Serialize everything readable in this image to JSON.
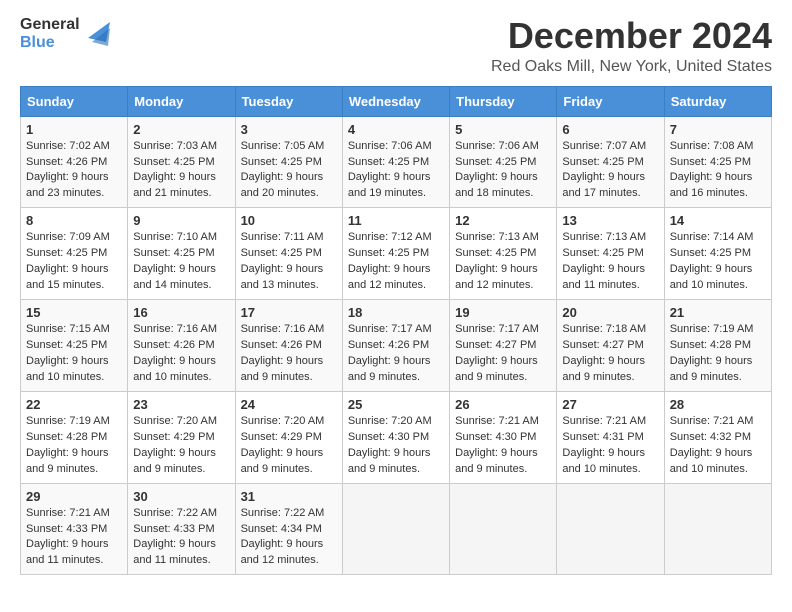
{
  "logo": {
    "text_general": "General",
    "text_blue": "Blue"
  },
  "header": {
    "title": "December 2024",
    "subtitle": "Red Oaks Mill, New York, United States"
  },
  "weekdays": [
    "Sunday",
    "Monday",
    "Tuesday",
    "Wednesday",
    "Thursday",
    "Friday",
    "Saturday"
  ],
  "weeks": [
    [
      {
        "day": "1",
        "sunrise": "7:02 AM",
        "sunset": "4:26 PM",
        "daylight": "9 hours and 23 minutes."
      },
      {
        "day": "2",
        "sunrise": "7:03 AM",
        "sunset": "4:25 PM",
        "daylight": "9 hours and 21 minutes."
      },
      {
        "day": "3",
        "sunrise": "7:05 AM",
        "sunset": "4:25 PM",
        "daylight": "9 hours and 20 minutes."
      },
      {
        "day": "4",
        "sunrise": "7:06 AM",
        "sunset": "4:25 PM",
        "daylight": "9 hours and 19 minutes."
      },
      {
        "day": "5",
        "sunrise": "7:06 AM",
        "sunset": "4:25 PM",
        "daylight": "9 hours and 18 minutes."
      },
      {
        "day": "6",
        "sunrise": "7:07 AM",
        "sunset": "4:25 PM",
        "daylight": "9 hours and 17 minutes."
      },
      {
        "day": "7",
        "sunrise": "7:08 AM",
        "sunset": "4:25 PM",
        "daylight": "9 hours and 16 minutes."
      }
    ],
    [
      {
        "day": "8",
        "sunrise": "7:09 AM",
        "sunset": "4:25 PM",
        "daylight": "9 hours and 15 minutes."
      },
      {
        "day": "9",
        "sunrise": "7:10 AM",
        "sunset": "4:25 PM",
        "daylight": "9 hours and 14 minutes."
      },
      {
        "day": "10",
        "sunrise": "7:11 AM",
        "sunset": "4:25 PM",
        "daylight": "9 hours and 13 minutes."
      },
      {
        "day": "11",
        "sunrise": "7:12 AM",
        "sunset": "4:25 PM",
        "daylight": "9 hours and 12 minutes."
      },
      {
        "day": "12",
        "sunrise": "7:13 AM",
        "sunset": "4:25 PM",
        "daylight": "9 hours and 12 minutes."
      },
      {
        "day": "13",
        "sunrise": "7:13 AM",
        "sunset": "4:25 PM",
        "daylight": "9 hours and 11 minutes."
      },
      {
        "day": "14",
        "sunrise": "7:14 AM",
        "sunset": "4:25 PM",
        "daylight": "9 hours and 10 minutes."
      }
    ],
    [
      {
        "day": "15",
        "sunrise": "7:15 AM",
        "sunset": "4:25 PM",
        "daylight": "9 hours and 10 minutes."
      },
      {
        "day": "16",
        "sunrise": "7:16 AM",
        "sunset": "4:26 PM",
        "daylight": "9 hours and 10 minutes."
      },
      {
        "day": "17",
        "sunrise": "7:16 AM",
        "sunset": "4:26 PM",
        "daylight": "9 hours and 9 minutes."
      },
      {
        "day": "18",
        "sunrise": "7:17 AM",
        "sunset": "4:26 PM",
        "daylight": "9 hours and 9 minutes."
      },
      {
        "day": "19",
        "sunrise": "7:17 AM",
        "sunset": "4:27 PM",
        "daylight": "9 hours and 9 minutes."
      },
      {
        "day": "20",
        "sunrise": "7:18 AM",
        "sunset": "4:27 PM",
        "daylight": "9 hours and 9 minutes."
      },
      {
        "day": "21",
        "sunrise": "7:19 AM",
        "sunset": "4:28 PM",
        "daylight": "9 hours and 9 minutes."
      }
    ],
    [
      {
        "day": "22",
        "sunrise": "7:19 AM",
        "sunset": "4:28 PM",
        "daylight": "9 hours and 9 minutes."
      },
      {
        "day": "23",
        "sunrise": "7:20 AM",
        "sunset": "4:29 PM",
        "daylight": "9 hours and 9 minutes."
      },
      {
        "day": "24",
        "sunrise": "7:20 AM",
        "sunset": "4:29 PM",
        "daylight": "9 hours and 9 minutes."
      },
      {
        "day": "25",
        "sunrise": "7:20 AM",
        "sunset": "4:30 PM",
        "daylight": "9 hours and 9 minutes."
      },
      {
        "day": "26",
        "sunrise": "7:21 AM",
        "sunset": "4:30 PM",
        "daylight": "9 hours and 9 minutes."
      },
      {
        "day": "27",
        "sunrise": "7:21 AM",
        "sunset": "4:31 PM",
        "daylight": "9 hours and 10 minutes."
      },
      {
        "day": "28",
        "sunrise": "7:21 AM",
        "sunset": "4:32 PM",
        "daylight": "9 hours and 10 minutes."
      }
    ],
    [
      {
        "day": "29",
        "sunrise": "7:21 AM",
        "sunset": "4:33 PM",
        "daylight": "9 hours and 11 minutes."
      },
      {
        "day": "30",
        "sunrise": "7:22 AM",
        "sunset": "4:33 PM",
        "daylight": "9 hours and 11 minutes."
      },
      {
        "day": "31",
        "sunrise": "7:22 AM",
        "sunset": "4:34 PM",
        "daylight": "9 hours and 12 minutes."
      },
      null,
      null,
      null,
      null
    ]
  ],
  "labels": {
    "sunrise": "Sunrise:",
    "sunset": "Sunset:",
    "daylight": "Daylight:"
  }
}
